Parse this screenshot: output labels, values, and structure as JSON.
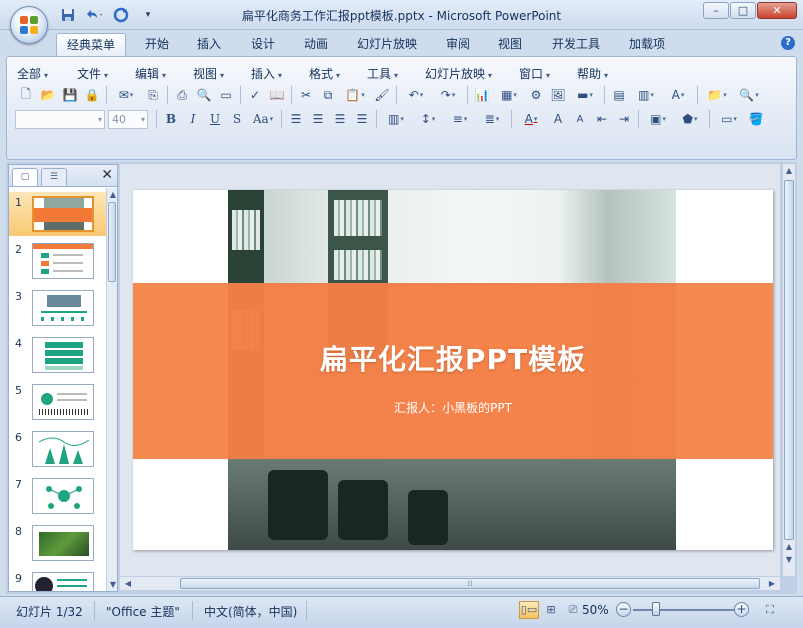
{
  "window": {
    "title": "扁平化商务工作汇报ppt模板.pptx - Microsoft PowerPoint",
    "minimize": "–",
    "maximize": "□",
    "close": "✕"
  },
  "qat": {
    "save_icon": "save-icon",
    "undo_icon": "undo-icon",
    "redo_icon": "redo-icon",
    "customize_icon": "customize-icon"
  },
  "tabs": [
    {
      "label": "经典菜单",
      "active": true
    },
    {
      "label": "开始"
    },
    {
      "label": "插入"
    },
    {
      "label": "设计"
    },
    {
      "label": "动画"
    },
    {
      "label": "幻灯片放映"
    },
    {
      "label": "审阅"
    },
    {
      "label": "视图"
    },
    {
      "label": "开发工具"
    },
    {
      "label": "加载项"
    }
  ],
  "menus": [
    {
      "label": "全部"
    },
    {
      "label": "文件"
    },
    {
      "label": "编辑"
    },
    {
      "label": "视图"
    },
    {
      "label": "插入"
    },
    {
      "label": "格式"
    },
    {
      "label": "工具"
    },
    {
      "label": "幻灯片放映"
    },
    {
      "label": "窗口"
    },
    {
      "label": "帮助"
    }
  ],
  "font": {
    "name_value": "",
    "size_value": "40"
  },
  "format_buttons": {
    "bold": "B",
    "italic": "I",
    "underline": "U",
    "shadow": "S",
    "case": "Aa"
  },
  "pane": {
    "close": "✕"
  },
  "slides": [
    {
      "num": "1",
      "selected": true,
      "variant": "title"
    },
    {
      "num": "2",
      "variant": "list"
    },
    {
      "num": "3",
      "variant": "photo"
    },
    {
      "num": "4",
      "variant": "bars"
    },
    {
      "num": "5",
      "variant": "timeline"
    },
    {
      "num": "6",
      "variant": "chart"
    },
    {
      "num": "7",
      "variant": "diagram"
    },
    {
      "num": "8",
      "variant": "green"
    },
    {
      "num": "9",
      "variant": "circle"
    }
  ],
  "slide": {
    "title": "扁平化汇报PPT模板",
    "subtitle": "汇报人：小黑板的PPT"
  },
  "status": {
    "slide_info": "幻灯片 1/32",
    "theme": "\"Office 主题\"",
    "language": "中文(简体，中国)",
    "zoom": "50%",
    "zoom_out": "−",
    "zoom_in": "+"
  },
  "colors": {
    "accent_orange": "#f47937",
    "thumb_green": "#1fa582",
    "selection": "#f8c972"
  }
}
